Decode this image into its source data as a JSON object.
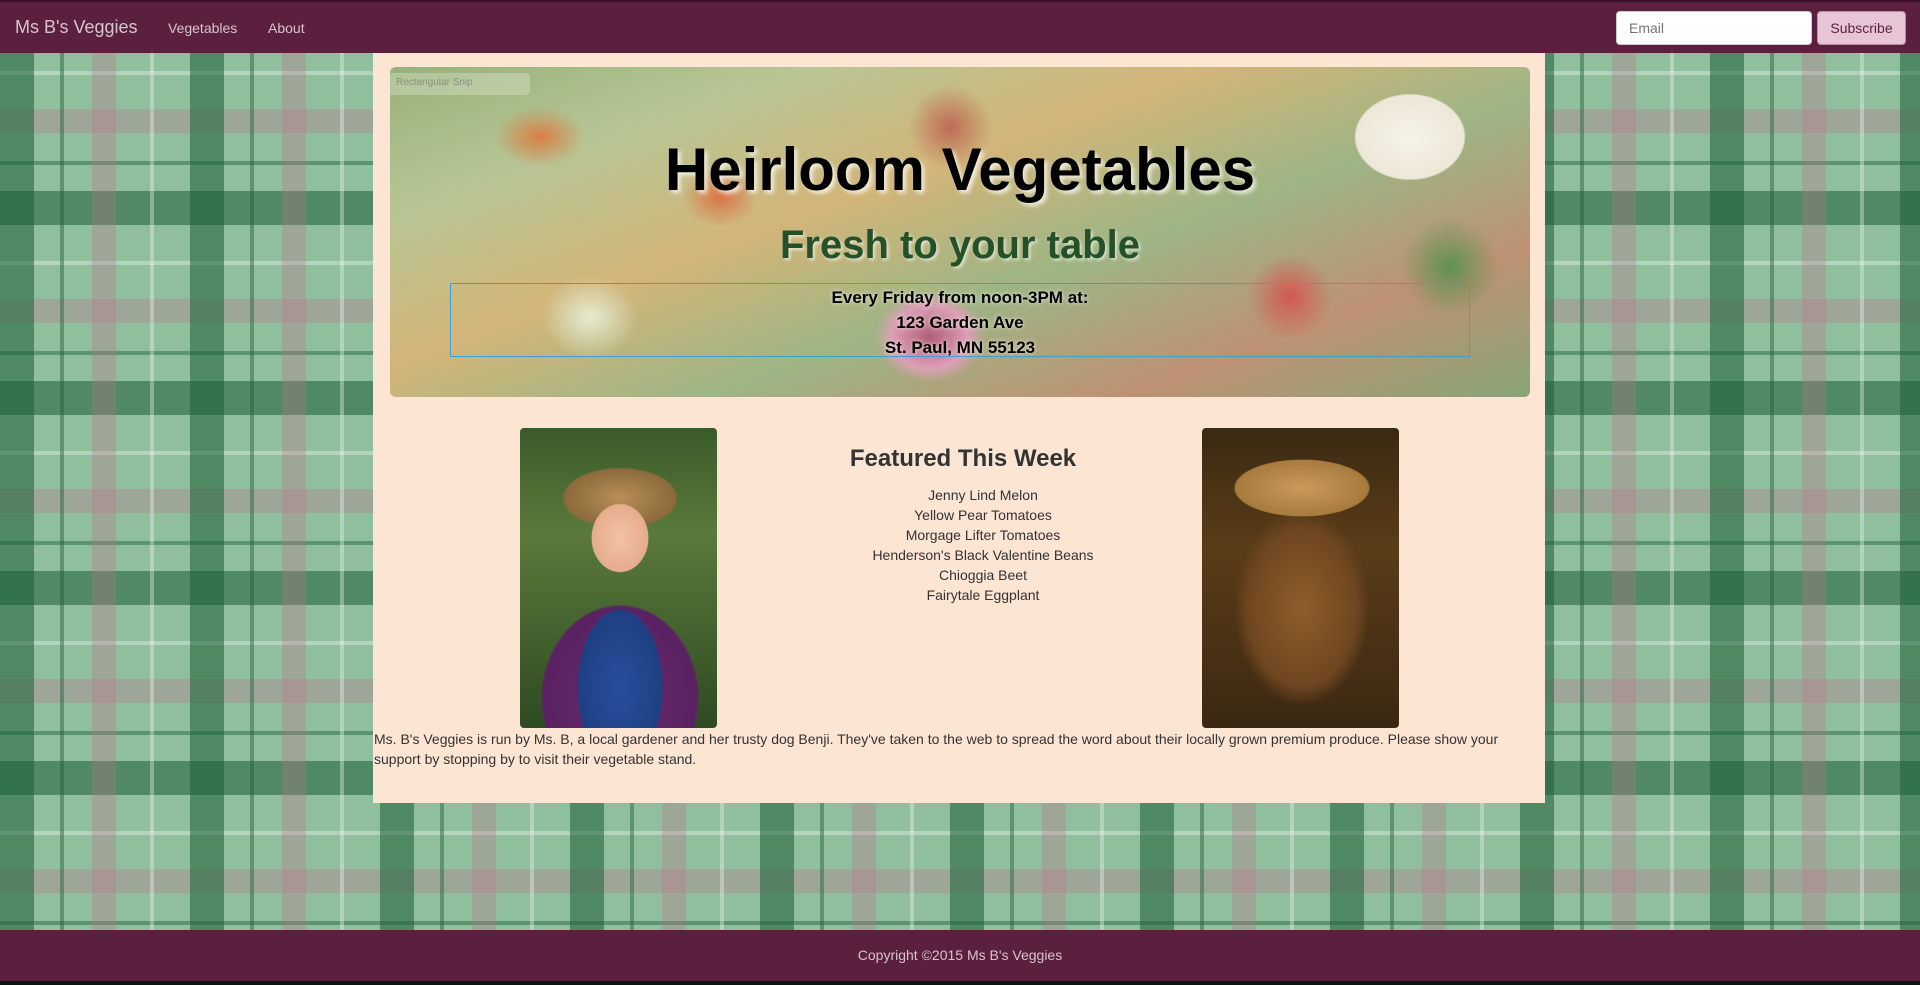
{
  "colors": {
    "nav_bg": "#5b1f40",
    "container_bg": "#fde5d4",
    "accent_green": "#24502a",
    "subscribe_bg": "#e8c5d6"
  },
  "navbar": {
    "brand": "Ms B's Veggies",
    "links": [
      "Vegetables",
      "About"
    ],
    "email_placeholder": "Email",
    "subscribe_label": "Subscribe"
  },
  "hero": {
    "watermark": "Rectangular Snip",
    "title": "Heirloom Vegetables",
    "subtitle": "Fresh to your table",
    "address_lines": [
      "Every Friday from noon-3PM at:",
      "123 Garden Ave",
      "St. Paul, MN 55123"
    ]
  },
  "featured": {
    "title": "Featured This Week",
    "items": [
      "Jenny Lind Melon",
      "Yellow Pear Tomatoes",
      "Morgage Lifter Tomatoes",
      "Henderson's Black Valentine Beans",
      "Chioggia Beet",
      "Fairytale Eggplant"
    ]
  },
  "intro": "Ms. B's Veggies is run by Ms. B, a local gardener and her trusty dog Benji. They've taken to the web to spread the word about their locally grown premium produce. Please show your support by stopping by to visit their vegetable stand.",
  "footer": {
    "copyright": "Copyright ©2015 Ms B's Veggies"
  }
}
